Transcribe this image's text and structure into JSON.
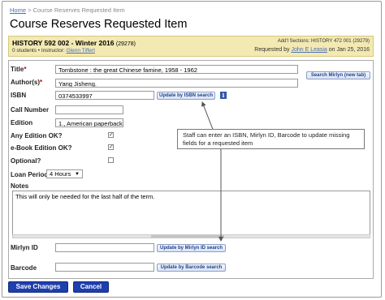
{
  "breadcrumb": {
    "home": "Home",
    "separator": ">",
    "current": "Course Reserves Requested Item"
  },
  "page_title": "Course Reserves Requested Item",
  "course": {
    "title": "HISTORY 592 002 - Winter 2016",
    "id": "(29278)",
    "students": "0 students",
    "instructor_label": "Instructor:",
    "instructor": "Glenn Tiffert",
    "addl_sections": "Add'l Sections: HISTORY 472 001 (29279)",
    "requested_by_label": "Requested by",
    "requested_by": "John E Leasia",
    "requested_on": "on Jan 25, 2016"
  },
  "form": {
    "title": {
      "label": "Title",
      "value": "Tombstone : the great Chinese famine, 1958 - 1962"
    },
    "authors": {
      "label": "Author(s)",
      "value": "Yang Jisheng."
    },
    "isbn": {
      "label": "ISBN",
      "value": "0374533997",
      "button": "Update by ISBN search"
    },
    "call_number": {
      "label": "Call Number",
      "value": ""
    },
    "edition": {
      "label": "Edition",
      "value": "1., American paperback ed."
    },
    "any_edition": {
      "label": "Any Edition OK?",
      "checked": "✓"
    },
    "ebook": {
      "label": "e-Book Edition OK?",
      "checked": "✓"
    },
    "optional": {
      "label": "Optional?",
      "checked": ""
    },
    "loan_period": {
      "label": "Loan Period",
      "value": "4 Hours"
    },
    "notes": {
      "label": "Notes",
      "value": "This will only be needed for the last half of the term."
    },
    "mirlyn_id": {
      "label": "Mirlyn ID",
      "value": "",
      "button": "Update by Mirlyn ID search"
    },
    "barcode": {
      "label": "Barcode",
      "value": "",
      "button": "Update by Barcode search"
    },
    "search_mirlyn_button": "Search Mirlyn (new tab)"
  },
  "callout": "Staff can enter an ISBN, Mirlyn ID, Barcode to update missing fields for a requested item",
  "actions": {
    "save": "Save Changes",
    "cancel": "Cancel"
  },
  "colors": {
    "primary_button": "#1f3fae",
    "course_band": "#f2e9b3",
    "link": "#4a6fb5",
    "required": "#cc0000"
  }
}
